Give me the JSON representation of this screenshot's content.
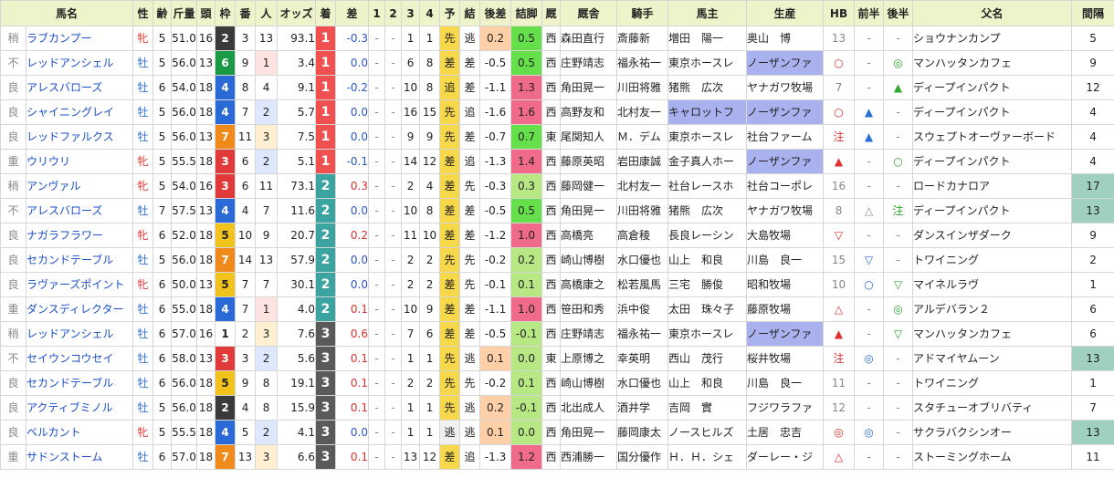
{
  "frame_colors": {
    "1": "#ffffff",
    "2": "#3a3a3a",
    "3": "#e03a3a",
    "4": "#2a6ad6",
    "5": "#f2c31b",
    "6": "#1a9a44",
    "7": "#f08a1a",
    "8": "#e080a8"
  },
  "headers": [
    "馬名",
    "性",
    "齢",
    "斤量",
    "頭",
    "枠",
    "番",
    "人",
    "オッズ",
    "着",
    "差",
    "1",
    "2",
    "3",
    "4",
    "予",
    "結",
    "後差",
    "詰脚",
    "厩",
    "厩舎",
    "騎手",
    "馬主",
    "生産",
    "HB",
    "前半",
    "後半",
    "父名",
    "間隔"
  ],
  "rows": [
    {
      "cond": "稍",
      "name": "ラブカンプー",
      "sex": "牝",
      "age": "5",
      "weight": "51.0",
      "heads": "16",
      "frame": "2",
      "num": "3",
      "pop": "13",
      "odds": "93.1",
      "fin": "1",
      "diff": "-0.3",
      "c1": "-",
      "c2": "-",
      "c3": "1",
      "c4": "1",
      "pred": "先",
      "res": "逃",
      "lag": "0.2",
      "lp": "0.5",
      "east": "西",
      "trainer": "森田直行",
      "jockey": "斎藤新",
      "owner": "増田　陽一",
      "breeder": "奥山　博",
      "hb": "13",
      "fh": "-",
      "sh": "-",
      "sire": "ショウナンカンプ",
      "int": "5"
    },
    {
      "cond": "不",
      "name": "レッドアンシェル",
      "sex": "牡",
      "age": "5",
      "weight": "56.0",
      "heads": "13",
      "frame": "6",
      "num": "9",
      "pop": "1",
      "odds": "3.4",
      "fin": "1",
      "diff": "0.0",
      "c1": "-",
      "c2": "-",
      "c3": "6",
      "c4": "8",
      "pred": "差",
      "res": "差",
      "lag": "-0.5",
      "lp": "0.5",
      "east": "西",
      "trainer": "庄野靖志",
      "jockey": "福永祐一",
      "owner": "東京ホースレ",
      "breeder": "ノーザンファ",
      "hb": "○",
      "fh": "-",
      "sh": "◎",
      "sire": "マンハッタンカフェ",
      "int": "9"
    },
    {
      "cond": "良",
      "name": "アレスバローズ",
      "sex": "牡",
      "age": "6",
      "weight": "54.0",
      "heads": "18",
      "frame": "4",
      "num": "8",
      "pop": "4",
      "odds": "9.1",
      "fin": "1",
      "diff": "-0.2",
      "c1": "-",
      "c2": "-",
      "c3": "10",
      "c4": "8",
      "pred": "追",
      "res": "差",
      "lag": "-1.1",
      "lp": "1.3",
      "east": "西",
      "trainer": "角田晃一",
      "jockey": "川田将雅",
      "owner": "猪熊　広次",
      "breeder": "ヤナガワ牧場",
      "hb": "7",
      "fh": "-",
      "sh": "▲",
      "sire": "ディープインパクト",
      "int": "12"
    },
    {
      "cond": "良",
      "name": "シャイニングレイ",
      "sex": "牡",
      "age": "5",
      "weight": "56.0",
      "heads": "18",
      "frame": "4",
      "num": "7",
      "pop": "2",
      "odds": "5.7",
      "fin": "1",
      "diff": "0.0",
      "c1": "-",
      "c2": "-",
      "c3": "16",
      "c4": "15",
      "pred": "先",
      "res": "追",
      "lag": "-1.6",
      "lp": "1.6",
      "east": "西",
      "trainer": "高野友和",
      "jockey": "北村友一",
      "owner": "キャロットフ",
      "breeder": "ノーザンファ",
      "hb": "○",
      "fh": "▲",
      "sh": "-",
      "sire": "ディープインパクト",
      "int": "4"
    },
    {
      "cond": "良",
      "name": "レッドファルクス",
      "sex": "牡",
      "age": "5",
      "weight": "56.0",
      "heads": "13",
      "frame": "7",
      "num": "11",
      "pop": "3",
      "odds": "7.5",
      "fin": "1",
      "diff": "0.0",
      "c1": "-",
      "c2": "-",
      "c3": "9",
      "c4": "9",
      "pred": "先",
      "res": "差",
      "lag": "-0.7",
      "lp": "0.7",
      "east": "東",
      "trainer": "尾関知人",
      "jockey": "Ｍ．デム",
      "owner": "東京ホースレ",
      "breeder": "社台ファーム",
      "hb": "注",
      "fh": "▲",
      "sh": "-",
      "sire": "スウェプトオーヴァーボード",
      "int": "4"
    },
    {
      "cond": "重",
      "name": "ウリウリ",
      "sex": "牝",
      "age": "5",
      "weight": "55.5",
      "heads": "18",
      "frame": "3",
      "num": "6",
      "pop": "2",
      "odds": "5.1",
      "fin": "1",
      "diff": "-0.1",
      "c1": "-",
      "c2": "-",
      "c3": "14",
      "c4": "12",
      "pred": "差",
      "res": "追",
      "lag": "-1.3",
      "lp": "1.4",
      "east": "西",
      "trainer": "藤原英昭",
      "jockey": "岩田康誠",
      "owner": "金子真人ホー",
      "breeder": "ノーザンファ",
      "hb": "▲",
      "fh": "-",
      "sh": "○",
      "sire": "ディープインパクト",
      "int": "4"
    },
    {
      "cond": "稍",
      "name": "アンヴァル",
      "sex": "牝",
      "age": "5",
      "weight": "54.0",
      "heads": "16",
      "frame": "3",
      "num": "6",
      "pop": "11",
      "odds": "73.1",
      "fin": "2",
      "diff": "0.3",
      "c1": "-",
      "c2": "-",
      "c3": "2",
      "c4": "4",
      "pred": "差",
      "res": "先",
      "lag": "-0.3",
      "lp": "0.3",
      "east": "西",
      "trainer": "藤岡健一",
      "jockey": "北村友一",
      "owner": "社台レースホ",
      "breeder": "社台コーポレ",
      "hb": "16",
      "fh": "-",
      "sh": "-",
      "sire": "ロードカナロア",
      "int": "17"
    },
    {
      "cond": "不",
      "name": "アレスバローズ",
      "sex": "牡",
      "age": "7",
      "weight": "57.5",
      "heads": "13",
      "frame": "4",
      "num": "4",
      "pop": "7",
      "odds": "11.6",
      "fin": "2",
      "diff": "0.0",
      "c1": "-",
      "c2": "-",
      "c3": "10",
      "c4": "8",
      "pred": "差",
      "res": "差",
      "lag": "-0.5",
      "lp": "0.5",
      "east": "西",
      "trainer": "角田晃一",
      "jockey": "川田将雅",
      "owner": "猪熊　広次",
      "breeder": "ヤナガワ牧場",
      "hb": "8",
      "fh": "△",
      "sh": "注",
      "sire": "ディープインパクト",
      "int": "13"
    },
    {
      "cond": "良",
      "name": "ナガラフラワー",
      "sex": "牝",
      "age": "6",
      "weight": "52.0",
      "heads": "18",
      "frame": "5",
      "num": "10",
      "pop": "9",
      "odds": "20.7",
      "fin": "2",
      "diff": "0.2",
      "c1": "-",
      "c2": "-",
      "c3": "11",
      "c4": "10",
      "pred": "差",
      "res": "差",
      "lag": "-1.2",
      "lp": "1.0",
      "east": "西",
      "trainer": "高橋亮",
      "jockey": "高倉稜",
      "owner": "長良レーシン",
      "breeder": "大島牧場",
      "hb": "▽",
      "fh": "-",
      "sh": "-",
      "sire": "ダンスインザダーク",
      "int": "9"
    },
    {
      "cond": "良",
      "name": "セカンドテーブル",
      "sex": "牡",
      "age": "5",
      "weight": "56.0",
      "heads": "18",
      "frame": "7",
      "num": "14",
      "pop": "13",
      "odds": "57.9",
      "fin": "2",
      "diff": "0.0",
      "c1": "-",
      "c2": "-",
      "c3": "2",
      "c4": "2",
      "pred": "先",
      "res": "先",
      "lag": "-0.2",
      "lp": "0.2",
      "east": "西",
      "trainer": "崎山博樹",
      "jockey": "水口優也",
      "owner": "山上　和良",
      "breeder": "川島　良一",
      "hb": "15",
      "fh": "▽",
      "sh": "-",
      "sire": "トワイニング",
      "int": "2"
    },
    {
      "cond": "良",
      "name": "ラヴァーズポイント",
      "sex": "牝",
      "age": "6",
      "weight": "50.0",
      "heads": "13",
      "frame": "5",
      "num": "7",
      "pop": "7",
      "odds": "30.1",
      "fin": "2",
      "diff": "0.0",
      "c1": "-",
      "c2": "-",
      "c3": "2",
      "c4": "2",
      "pred": "差",
      "res": "先",
      "lag": "-0.1",
      "lp": "0.1",
      "east": "西",
      "trainer": "高橋康之",
      "jockey": "松若風馬",
      "owner": "三宅　勝俊",
      "breeder": "昭和牧場",
      "hb": "10",
      "fh": "○",
      "sh": "▽",
      "sire": "マイネルラヴ",
      "int": "1"
    },
    {
      "cond": "重",
      "name": "ダンスディレクター",
      "sex": "牡",
      "age": "6",
      "weight": "55.0",
      "heads": "18",
      "frame": "4",
      "num": "7",
      "pop": "1",
      "odds": "4.0",
      "fin": "2",
      "diff": "0.1",
      "c1": "-",
      "c2": "-",
      "c3": "10",
      "c4": "9",
      "pred": "差",
      "res": "差",
      "lag": "-1.1",
      "lp": "1.0",
      "east": "西",
      "trainer": "笹田和秀",
      "jockey": "浜中俊",
      "owner": "太田　珠々子",
      "breeder": "藤原牧場",
      "hb": "△",
      "fh": "-",
      "sh": "◎",
      "sire": "アルデバラン２",
      "int": "6"
    },
    {
      "cond": "稍",
      "name": "レッドアンシェル",
      "sex": "牡",
      "age": "6",
      "weight": "57.0",
      "heads": "16",
      "frame": "1",
      "num": "2",
      "pop": "3",
      "odds": "7.6",
      "fin": "3",
      "diff": "0.6",
      "c1": "-",
      "c2": "-",
      "c3": "7",
      "c4": "6",
      "pred": "差",
      "res": "差",
      "lag": "-0.5",
      "lp": "-0.1",
      "east": "西",
      "trainer": "庄野靖志",
      "jockey": "福永祐一",
      "owner": "東京ホースレ",
      "breeder": "ノーザンファ",
      "hb": "▲",
      "fh": "-",
      "sh": "▽",
      "sire": "マンハッタンカフェ",
      "int": "6"
    },
    {
      "cond": "不",
      "name": "セイウンコウセイ",
      "sex": "牡",
      "age": "6",
      "weight": "58.0",
      "heads": "13",
      "frame": "3",
      "num": "3",
      "pop": "2",
      "odds": "5.6",
      "fin": "3",
      "diff": "0.1",
      "c1": "-",
      "c2": "-",
      "c3": "1",
      "c4": "1",
      "pred": "先",
      "res": "逃",
      "lag": "0.1",
      "lp": "0.0",
      "east": "東",
      "trainer": "上原博之",
      "jockey": "幸英明",
      "owner": "西山　茂行",
      "breeder": "桜井牧場",
      "hb": "注",
      "fh": "◎",
      "sh": "-",
      "sire": "アドマイヤムーン",
      "int": "13"
    },
    {
      "cond": "良",
      "name": "セカンドテーブル",
      "sex": "牡",
      "age": "6",
      "weight": "56.0",
      "heads": "18",
      "frame": "5",
      "num": "9",
      "pop": "8",
      "odds": "19.1",
      "fin": "3",
      "diff": "0.1",
      "c1": "-",
      "c2": "-",
      "c3": "2",
      "c4": "2",
      "pred": "先",
      "res": "先",
      "lag": "-0.2",
      "lp": "0.1",
      "east": "西",
      "trainer": "崎山博樹",
      "jockey": "水口優也",
      "owner": "山上　和良",
      "breeder": "川島　良一",
      "hb": "11",
      "fh": "-",
      "sh": "-",
      "sire": "トワイニング",
      "int": "1"
    },
    {
      "cond": "良",
      "name": "アクティブミノル",
      "sex": "牡",
      "age": "5",
      "weight": "56.0",
      "heads": "18",
      "frame": "2",
      "num": "4",
      "pop": "8",
      "odds": "15.9",
      "fin": "3",
      "diff": "0.1",
      "c1": "-",
      "c2": "-",
      "c3": "1",
      "c4": "1",
      "pred": "先",
      "res": "逃",
      "lag": "0.2",
      "lp": "-0.1",
      "east": "西",
      "trainer": "北出成人",
      "jockey": "酒井学",
      "owner": "吉岡　實",
      "breeder": "フジワラファ",
      "hb": "12",
      "fh": "-",
      "sh": "-",
      "sire": "スタチューオブリバティ",
      "int": "7"
    },
    {
      "cond": "良",
      "name": "ベルカント",
      "sex": "牝",
      "age": "5",
      "weight": "55.5",
      "heads": "18",
      "frame": "4",
      "num": "5",
      "pop": "2",
      "odds": "4.1",
      "fin": "3",
      "diff": "0.0",
      "c1": "-",
      "c2": "-",
      "c3": "1",
      "c4": "1",
      "pred": "逃",
      "res": "逃",
      "lag": "0.1",
      "lp": "0.0",
      "east": "西",
      "trainer": "角田晃一",
      "jockey": "藤岡康太",
      "owner": "ノースヒルズ",
      "breeder": "土居　忠吉",
      "hb": "◎",
      "fh": "◎",
      "sh": "-",
      "sire": "サクラバクシンオー",
      "int": "13"
    },
    {
      "cond": "重",
      "name": "サドンストーム",
      "sex": "牡",
      "age": "6",
      "weight": "57.0",
      "heads": "18",
      "frame": "7",
      "num": "13",
      "pop": "3",
      "odds": "6.6",
      "fin": "3",
      "diff": "0.1",
      "c1": "-",
      "c2": "-",
      "c3": "13",
      "c4": "12",
      "pred": "差",
      "res": "追",
      "lag": "-1.3",
      "lp": "1.2",
      "east": "西",
      "trainer": "西浦勝一",
      "jockey": "国分優作",
      "owner": "Ｈ．Ｈ．シェ",
      "breeder": "ダーレー・ジ",
      "hb": "△",
      "fh": "-",
      "sh": "-",
      "sire": "ストーミングホーム",
      "int": "11"
    }
  ]
}
